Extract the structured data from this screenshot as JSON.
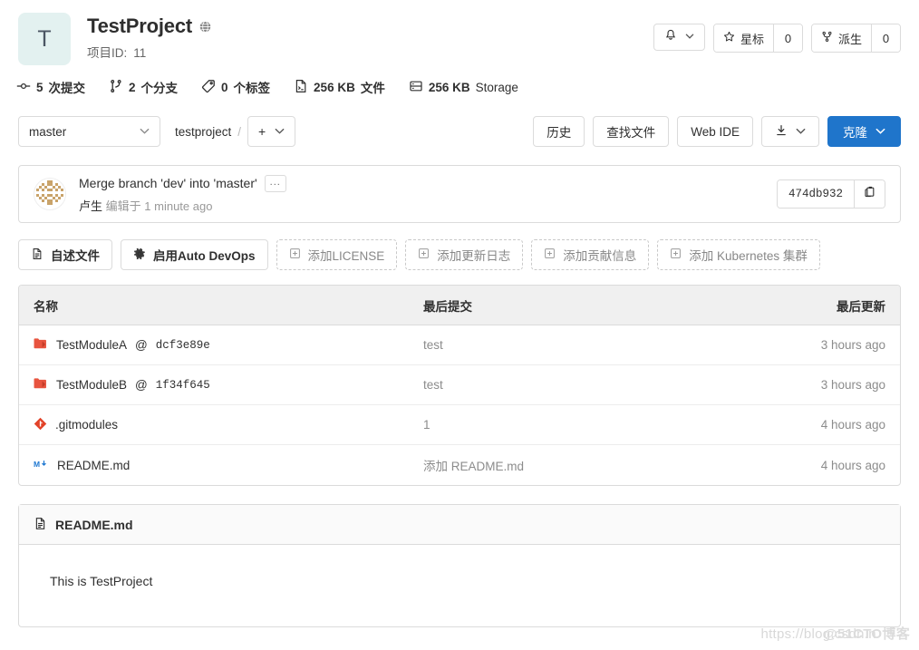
{
  "project": {
    "avatar_letter": "T",
    "avatar_bg": "#e3f1f0",
    "title": "TestProject",
    "visibility_icon": "globe-icon",
    "id_label": "项目ID:",
    "id_value": "11"
  },
  "header_actions": {
    "notification_icon": "bell-icon",
    "star_label": "星标",
    "star_count": "0",
    "fork_label": "派生",
    "fork_count": "0"
  },
  "stats": [
    {
      "icon": "commit-icon",
      "value": "5",
      "unit": "次提交",
      "bold_unit": true
    },
    {
      "icon": "branch-icon",
      "value": "2",
      "unit": "个分支",
      "bold_unit": true
    },
    {
      "icon": "tag-icon",
      "value": "0",
      "unit": "个标签",
      "bold_unit": true
    },
    {
      "icon": "file-icon",
      "value": "256 KB",
      "unit": "文件",
      "bold_unit": true
    },
    {
      "icon": "storage-icon",
      "value": "256 KB",
      "unit": "Storage",
      "bold_unit": false
    }
  ],
  "toolbar": {
    "branch": "master",
    "breadcrumb_root": "testproject",
    "breadcrumb_sep": "/",
    "add_plus": "+",
    "history_label": "历史",
    "find_file_label": "查找文件",
    "web_ide_label": "Web IDE",
    "download_icon": "download-icon",
    "clone_label": "克隆"
  },
  "commit": {
    "avatar_icon": "identicon-avatar",
    "title": "Merge branch 'dev' into 'master'",
    "more_label": "...",
    "author": "卢生",
    "action": "编辑于",
    "time": "1 minute ago",
    "sha": "474db932",
    "copy_icon": "clipboard-icon"
  },
  "quick_actions": [
    {
      "label": "自述文件",
      "icon": "document-icon",
      "style": "solid"
    },
    {
      "label": "启用Auto DevOps",
      "icon": "gear-icon",
      "style": "solid"
    },
    {
      "label": "添加LICENSE",
      "icon": "plus-square-icon",
      "style": "dashed"
    },
    {
      "label": "添加更新日志",
      "icon": "plus-square-icon",
      "style": "dashed"
    },
    {
      "label": "添加贡献信息",
      "icon": "plus-square-icon",
      "style": "dashed"
    },
    {
      "label": "添加 Kubernetes 集群",
      "icon": "plus-square-icon",
      "style": "dashed"
    }
  ],
  "file_table": {
    "columns": {
      "name": "名称",
      "last_commit": "最后提交",
      "last_update": "最后更新"
    },
    "rows": [
      {
        "icon": "submodule-folder-icon",
        "name": "TestModuleA",
        "at": "@",
        "sha": "dcf3e89e",
        "last_commit": "test",
        "last_update": "3 hours ago"
      },
      {
        "icon": "submodule-folder-icon",
        "name": "TestModuleB",
        "at": "@",
        "sha": "1f34f645",
        "last_commit": "test",
        "last_update": "3 hours ago"
      },
      {
        "icon": "git-file-icon",
        "name": ".gitmodules",
        "at": "",
        "sha": "",
        "last_commit": "1",
        "last_update": "4 hours ago"
      },
      {
        "icon": "markdown-file-icon",
        "name": "README.md",
        "at": "",
        "sha": "",
        "last_commit": "添加 README.md",
        "last_update": "4 hours ago"
      }
    ]
  },
  "readme": {
    "icon": "document-icon",
    "filename": "README.md",
    "content": "This is TestProject"
  },
  "watermark": {
    "text1": "https://blog.csdn.n",
    "text2": "@51CTO博客"
  },
  "colors": {
    "accent": "#1f75cb",
    "submodule_orange": "#e24329",
    "markdown_blue": "#1f78d1",
    "muted_text": "#8c8c8c",
    "border": "#dbdbdb"
  }
}
